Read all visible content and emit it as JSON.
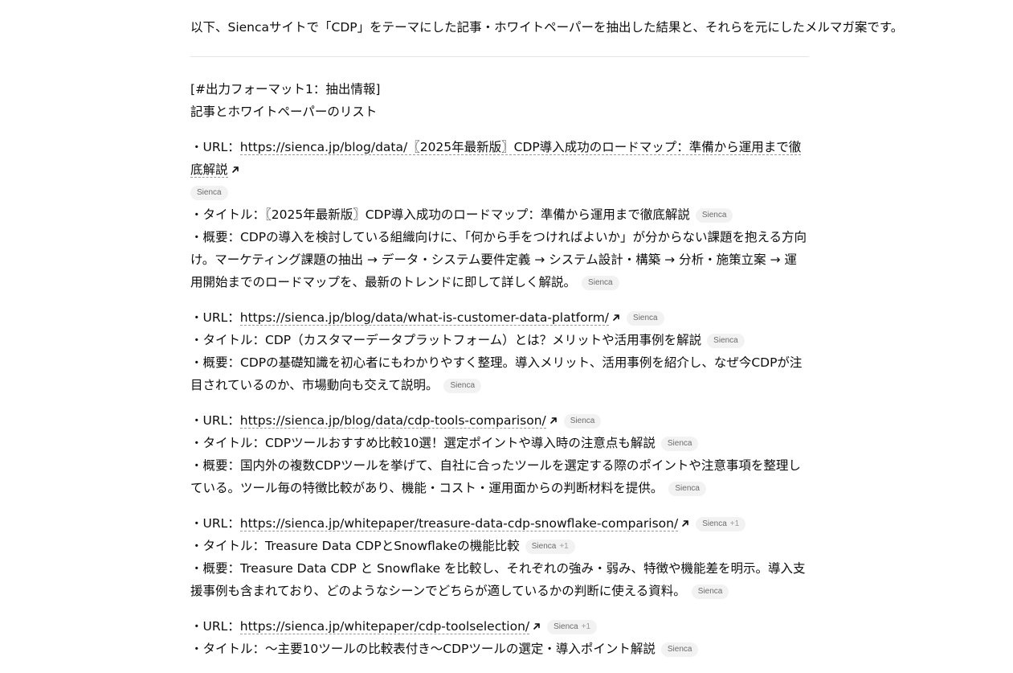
{
  "intro": "以下、Siencaサイトで「CDP」をテーマにした記事・ホワイトペーパーを抽出した結果と、それらを元にしたメルマガ案です。",
  "heading": "[#出力フォーマット1：抽出情報]",
  "subheading": "記事とホワイトペーパーのリスト",
  "labels": {
    "url": "・URL：",
    "title": "・タイトル：",
    "summary": "・概要："
  },
  "badges": {
    "source": "Sienca",
    "plus": "+1"
  },
  "entries": [
    {
      "url": "https://sienca.jp/blog/data/〖2025年最新版〗CDP導入成功のロードマップ：準備から運用まで徹底解説",
      "title": "〖2025年最新版〗CDP導入成功のロードマップ：準備から運用まで徹底解説",
      "summary": "CDPの導入を検討している組織向けに、「何から手をつければよいか」が分からない課題を抱える方向け。マーケティング課題の抽出 → データ・システム要件定義 → システム設計・構築 → 分析・施策立案 → 運用開始までのロードマップを、最新のトレンドに即して詳しく解説。"
    },
    {
      "url": "https://sienca.jp/blog/data/what-is-customer-data-platform/",
      "title": "CDP（カスタマーデータプラットフォーム）とは？メリットや活用事例を解説",
      "summary": "CDPの基礎知識を初心者にもわかりやすく整理。導入メリット、活用事例を紹介し、なぜ今CDPが注目されているのか、市場動向も交えて説明。"
    },
    {
      "url": "https://sienca.jp/blog/data/cdp-tools-comparison/",
      "title": "CDPツールおすすめ比較10選！選定ポイントや導入時の注意点も解説",
      "summary": "国内外の複数CDPツールを挙げて、自社に合ったツールを選定する際のポイントや注意事項を整理している。ツール毎の特徴比較があり、機能・コスト・運用面からの判断材料を提供。"
    },
    {
      "url": "https://sienca.jp/whitepaper/treasure-data-cdp-snowflake-comparison/",
      "title": "Treasure Data CDPとSnowflakeの機能比較",
      "summary": "Treasure Data CDP と Snowflake を比較し、それぞれの強み・弱み、特徴や機能差を明示。導入支援事例も含まれており、どのようなシーンでどちらが適しているかの判断に使える資料。"
    },
    {
      "url": "https://sienca.jp/whitepaper/cdp-toolselection/",
      "title": "〜主要10ツールの比較表付き〜CDPツールの選定・導入ポイント解説"
    }
  ]
}
